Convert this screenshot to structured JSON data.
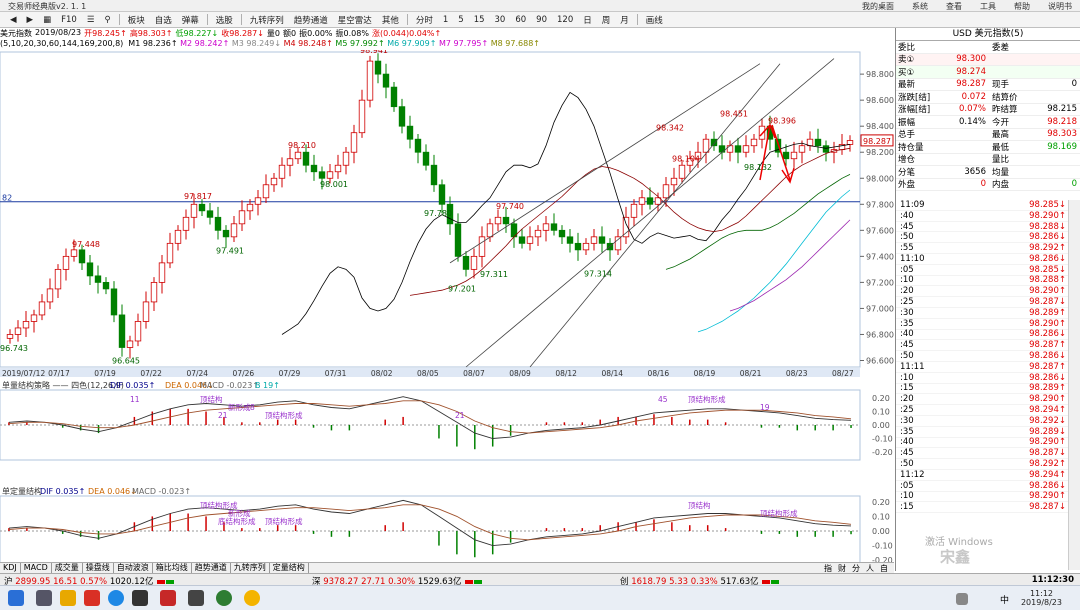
{
  "window": {
    "title": "交易师经典版v2. 1. 1",
    "menus": [
      "我的桌面",
      "系统",
      "查看",
      "工具",
      "帮助",
      "说明书"
    ]
  },
  "toolbar": {
    "left_items": [
      "板块",
      "自选",
      "弹幕"
    ],
    "items": [
      "选股",
      "九转序列",
      "趋势通道",
      "星空雷达",
      "其他"
    ],
    "periods": [
      "分时",
      "1",
      "5",
      "15",
      "30",
      "60",
      "90",
      "120",
      "日",
      "周",
      "月"
    ],
    "draw": "画线"
  },
  "quote_line": {
    "name": "美元指数",
    "date": "2019/08/23",
    "open": "开98.245↑",
    "high": "高98.303↑",
    "low": "低98.227↓",
    "close": "收98.287↓",
    "volume": "量0",
    "amount": "额0",
    "change_pct": "振0.00%",
    "amp": "振0.08%",
    "chg": "涨(0.044)0.04%↑"
  },
  "ma_line": {
    "params": "(5,10,20,30,60,144,169,200,8)",
    "items": [
      {
        "label": "M1 98.236↑",
        "color": "#000000"
      },
      {
        "label": "M2 98.242↑",
        "color": "#cc00cc"
      },
      {
        "label": "M3 98.249↓",
        "color": "#888888"
      },
      {
        "label": "M4 98.248↑",
        "color": "#cc0000"
      },
      {
        "label": "M5 97.992↑",
        "color": "#008800"
      },
      {
        "label": "M6 97.909↑",
        "color": "#00aaaa"
      },
      {
        "label": "M7 97.795↑",
        "color": "#cc00cc"
      },
      {
        "label": "M8 97.688↑",
        "color": "#888800"
      }
    ]
  },
  "chart_data": {
    "type": "candlestick",
    "title": "美元指数",
    "x_ticks": [
      "2019/07/12",
      "07/17",
      "07/19",
      "07/22",
      "07/24",
      "07/26",
      "07/29",
      "07/31",
      "08/02",
      "08/05",
      "08/07",
      "08/09",
      "08/12",
      "08/14",
      "08/16",
      "08/19",
      "08/21",
      "08/23",
      "08/27"
    ],
    "y_ticks": [
      96.6,
      96.8,
      97.0,
      97.2,
      97.4,
      97.6,
      97.8,
      98.0,
      98.2,
      98.4,
      98.6,
      98.8
    ],
    "ylim": [
      96.55,
      98.97
    ],
    "h_line": 97.82,
    "h_line_label": "82",
    "annotations": [
      {
        "text": "96.743",
        "v": 96.743
      },
      {
        "text": "97.448",
        "v": 97.448
      },
      {
        "text": "96.645",
        "v": 96.645
      },
      {
        "text": "97.817",
        "v": 97.817
      },
      {
        "text": "97.491",
        "v": 97.491
      },
      {
        "text": "98.210",
        "v": 98.21
      },
      {
        "text": "98.001",
        "v": 98.001
      },
      {
        "text": "98.941",
        "v": 98.941
      },
      {
        "text": "97.780",
        "v": 97.78
      },
      {
        "text": "97.201",
        "v": 97.201
      },
      {
        "text": "97.311",
        "v": 97.311
      },
      {
        "text": "97.740",
        "v": 97.74
      },
      {
        "text": "97.314",
        "v": 97.314
      },
      {
        "text": "98.342",
        "v": 98.342
      },
      {
        "text": "98.104",
        "v": 98.104
      },
      {
        "text": "98.451",
        "v": 98.451
      },
      {
        "text": "98.396",
        "v": 98.396
      },
      {
        "text": "98.132",
        "v": 98.132
      }
    ],
    "current_price": "98.287",
    "closes": [
      96.8,
      96.85,
      96.9,
      96.95,
      97.05,
      97.15,
      97.3,
      97.4,
      97.45,
      97.35,
      97.25,
      97.2,
      97.15,
      96.95,
      96.7,
      96.75,
      96.9,
      97.05,
      97.2,
      97.35,
      97.5,
      97.6,
      97.7,
      97.8,
      97.75,
      97.7,
      97.6,
      97.55,
      97.65,
      97.75,
      97.8,
      97.85,
      97.95,
      98.0,
      98.1,
      98.15,
      98.2,
      98.1,
      98.05,
      98.0,
      98.05,
      98.1,
      98.2,
      98.35,
      98.6,
      98.9,
      98.8,
      98.7,
      98.55,
      98.4,
      98.3,
      98.2,
      98.1,
      97.95,
      97.8,
      97.65,
      97.4,
      97.3,
      97.4,
      97.55,
      97.65,
      97.7,
      97.65,
      97.55,
      97.5,
      97.55,
      97.6,
      97.65,
      97.6,
      97.55,
      97.5,
      97.45,
      97.5,
      97.55,
      97.5,
      97.45,
      97.55,
      97.7,
      97.8,
      97.85,
      97.8,
      97.85,
      97.95,
      98.0,
      98.1,
      98.15,
      98.2,
      98.3,
      98.25,
      98.2,
      98.25,
      98.2,
      98.25,
      98.3,
      98.4,
      98.3,
      98.2,
      98.15,
      98.2,
      98.25,
      98.3,
      98.25,
      98.2,
      98.22,
      98.26,
      98.29
    ],
    "ma_series": [
      {
        "name": "M5",
        "values": [
          96.8,
          96.84,
          96.88,
          96.96,
          97.06,
          97.17,
          97.27,
          97.32,
          97.3,
          97.24,
          97.08,
          97.0,
          96.98,
          97.0,
          97.07,
          97.2,
          97.36,
          97.5,
          97.61,
          97.68,
          97.72,
          97.69,
          97.66,
          97.66,
          97.72,
          97.79,
          97.85,
          97.95,
          98.05,
          98.1,
          98.1,
          98.08,
          98.11,
          98.25,
          98.43,
          98.56,
          98.66,
          98.62,
          98.53,
          98.4,
          98.22,
          98.04,
          97.84,
          97.65,
          97.53,
          97.5,
          97.55,
          97.58,
          97.56,
          97.54,
          97.55,
          97.56,
          97.53,
          97.52,
          97.59,
          97.68,
          97.75,
          97.84,
          97.92,
          98.02,
          98.12,
          98.2,
          98.22,
          98.24,
          98.26,
          98.27,
          98.25,
          98.24,
          98.23,
          98.24,
          98.25,
          98.26
        ]
      },
      {
        "name": "M20",
        "values": [
          97.1,
          97.11,
          97.12,
          97.13,
          97.14,
          97.16,
          97.18,
          97.21,
          97.25,
          97.3,
          97.36,
          97.42,
          97.48,
          97.55,
          97.61,
          97.66,
          97.71,
          97.76,
          97.81,
          97.86,
          97.92,
          97.98,
          98.03,
          98.07,
          98.09,
          98.08,
          98.06,
          98.03,
          98.0,
          97.96,
          97.91,
          97.86,
          97.8,
          97.74,
          97.69,
          97.65,
          97.62,
          97.6,
          97.59,
          97.6,
          97.63,
          97.66,
          97.71,
          97.77,
          97.83,
          97.89,
          97.95,
          98.01,
          98.06,
          98.1,
          98.13,
          98.16,
          98.19,
          98.21,
          98.22,
          98.23
        ]
      },
      {
        "name": "M60",
        "values": [
          97.3,
          97.32,
          97.35,
          97.38,
          97.42,
          97.46,
          97.5,
          97.54,
          97.57,
          97.59,
          97.6,
          97.6,
          97.6,
          97.62,
          97.65,
          97.69,
          97.73,
          97.78,
          97.83,
          97.88,
          97.92,
          97.96,
          98.0,
          98.03
        ]
      },
      {
        "name": "M144",
        "values": [
          96.82,
          96.84,
          96.87,
          96.9,
          96.94,
          96.98,
          97.03,
          97.08,
          97.14,
          97.2,
          97.27,
          97.34,
          97.42,
          97.5,
          97.58,
          97.66,
          97.74,
          97.8,
          97.86,
          97.91
        ]
      },
      {
        "name": "M200",
        "values": [
          96.98,
          97.0,
          97.03,
          97.06,
          97.1,
          97.14,
          97.18,
          97.22,
          97.27,
          97.32,
          97.38,
          97.44,
          97.5,
          97.56,
          97.62,
          97.68
        ]
      }
    ],
    "macd1": {
      "title": "单量结构策略 —— 四色(12,26,9)",
      "dif": "DIF 0.035↑",
      "dea": "DEA 0.046↓",
      "macd": "MACD -0.023↑",
      "extra": "B 19↑",
      "y_ticks": [
        0.2,
        0.1,
        0,
        -0.1,
        -0.2
      ],
      "ylim": [
        -0.26,
        0.26
      ],
      "labels": [
        "顶结构",
        "新形成",
        "顶结构形成",
        "顶结构形成",
        "19",
        "21",
        "11",
        "8",
        "21",
        "45"
      ],
      "dif_values": [
        0.02,
        0.03,
        0.02,
        0.0,
        -0.03,
        -0.05,
        -0.02,
        0.03,
        0.08,
        0.12,
        0.15,
        0.16,
        0.15,
        0.14,
        0.15,
        0.17,
        0.18,
        0.15,
        0.13,
        0.12,
        0.15,
        0.18,
        0.21,
        0.18,
        0.1,
        0.02,
        -0.06,
        -0.1,
        -0.09,
        -0.06,
        -0.04,
        -0.03,
        -0.02,
        0.0,
        0.03,
        0.06,
        0.09,
        0.1,
        0.11,
        0.12,
        0.12,
        0.11,
        0.1,
        0.09,
        0.07,
        0.05,
        0.04,
        0.035
      ],
      "dea_values": [
        0.01,
        0.02,
        0.02,
        0.01,
        -0.01,
        -0.02,
        -0.02,
        0.0,
        0.03,
        0.06,
        0.09,
        0.11,
        0.12,
        0.13,
        0.14,
        0.15,
        0.16,
        0.16,
        0.15,
        0.14,
        0.15,
        0.16,
        0.18,
        0.18,
        0.15,
        0.1,
        0.03,
        -0.02,
        -0.05,
        -0.06,
        -0.05,
        -0.04,
        -0.03,
        -0.02,
        0.0,
        0.03,
        0.05,
        0.07,
        0.09,
        0.1,
        0.11,
        0.11,
        0.11,
        0.1,
        0.09,
        0.07,
        0.06,
        0.046
      ]
    },
    "macd2": {
      "title": "单定量结构",
      "dif": "DIF 0.035↑",
      "dea": "DEA 0.046↓",
      "macd": "MACD -0.023↑",
      "y_ticks": [
        0.2,
        0.1,
        0,
        -0.1,
        -0.2
      ],
      "ylim": [
        -0.24,
        0.24
      ],
      "labels": [
        "顶结构形成",
        "新形成",
        "顶结构形成",
        "顶结构",
        "顶结构形成",
        "底结构形成"
      ],
      "dif_values": [
        0.02,
        0.03,
        0.02,
        0.0,
        -0.03,
        -0.05,
        -0.02,
        0.03,
        0.08,
        0.12,
        0.15,
        0.16,
        0.15,
        0.14,
        0.15,
        0.17,
        0.18,
        0.15,
        0.13,
        0.12,
        0.15,
        0.18,
        0.21,
        0.18,
        0.1,
        0.02,
        -0.06,
        -0.1,
        -0.09,
        -0.06,
        -0.04,
        -0.03,
        -0.02,
        0.0,
        0.03,
        0.06,
        0.09,
        0.1,
        0.11,
        0.12,
        0.12,
        0.11,
        0.1,
        0.09,
        0.07,
        0.05,
        0.04,
        0.035
      ],
      "dea_values": [
        0.01,
        0.02,
        0.02,
        0.01,
        -0.01,
        -0.02,
        -0.02,
        0.0,
        0.03,
        0.06,
        0.09,
        0.11,
        0.12,
        0.13,
        0.14,
        0.15,
        0.16,
        0.16,
        0.15,
        0.14,
        0.15,
        0.16,
        0.18,
        0.18,
        0.15,
        0.1,
        0.03,
        -0.02,
        -0.05,
        -0.06,
        -0.05,
        -0.04,
        -0.03,
        -0.02,
        0.0,
        0.03,
        0.05,
        0.07,
        0.09,
        0.1,
        0.11,
        0.11,
        0.11,
        0.1,
        0.09,
        0.07,
        0.06,
        0.046
      ]
    }
  },
  "right_panel": {
    "title": "USD 美元指数(5)",
    "header": {
      "l": "委比",
      "r": "委差"
    },
    "sell": {
      "label": "卖①",
      "value": "98.300"
    },
    "buy": {
      "label": "买①",
      "value": "98.274"
    },
    "rows": [
      {
        "l": "最新",
        "v": "98.287",
        "vc": "red",
        "l2": "现手",
        "v2": "0",
        "v2c": "blk"
      },
      {
        "l": "涨跌[结]",
        "v": "0.072",
        "vc": "red",
        "l2": "结算价",
        "v2": "",
        "v2c": "blk"
      },
      {
        "l": "涨幅[结]",
        "v": "0.07%",
        "vc": "red",
        "l2": "昨结算",
        "v2": "98.215",
        "v2c": "blk"
      },
      {
        "l": "振幅",
        "v": "0.14%",
        "vc": "blk",
        "l2": "今开",
        "v2": "98.218",
        "v2c": "red"
      },
      {
        "l": "总手",
        "v": "",
        "vc": "blk",
        "l2": "最高",
        "v2": "98.303",
        "v2c": "red"
      },
      {
        "l": "持仓量",
        "v": "",
        "vc": "blk",
        "l2": "最低",
        "v2": "98.169",
        "v2c": "green"
      },
      {
        "l": "增仓",
        "v": "",
        "vc": "blk",
        "l2": "量比",
        "v2": "",
        "v2c": "blk"
      },
      {
        "l": "分笔",
        "v": "3656",
        "vc": "blk",
        "l2": "均量",
        "v2": "",
        "v2c": "blk"
      },
      {
        "l": "外盘",
        "v": "0",
        "vc": "red",
        "l2": "内盘",
        "v2": "0",
        "v2c": "green"
      }
    ],
    "ticks": [
      {
        "t": "11:09",
        "p": "98.285↓"
      },
      {
        "t": ":40",
        "p": "98.290↑"
      },
      {
        "t": ":45",
        "p": "98.288↓"
      },
      {
        "t": ":50",
        "p": "98.286↓"
      },
      {
        "t": ":55",
        "p": "98.292↑"
      },
      {
        "t": "11:10",
        "p": "98.286↓"
      },
      {
        "t": ":05",
        "p": "98.285↓"
      },
      {
        "t": ":10",
        "p": "98.288↑"
      },
      {
        "t": ":20",
        "p": "98.290↑"
      },
      {
        "t": ":25",
        "p": "98.287↓"
      },
      {
        "t": ":30",
        "p": "98.289↑"
      },
      {
        "t": ":35",
        "p": "98.290↑"
      },
      {
        "t": ":40",
        "p": "98.286↓"
      },
      {
        "t": ":45",
        "p": "98.287↑"
      },
      {
        "t": ":50",
        "p": "98.286↓"
      },
      {
        "t": "11:11",
        "p": "98.287↑"
      },
      {
        "t": ":10",
        "p": "98.286↓"
      },
      {
        "t": ":15",
        "p": "98.289↑"
      },
      {
        "t": ":20",
        "p": "98.290↑"
      },
      {
        "t": ":25",
        "p": "98.294↑"
      },
      {
        "t": ":30",
        "p": "98.292↓"
      },
      {
        "t": ":35",
        "p": "98.289↓"
      },
      {
        "t": ":40",
        "p": "98.290↑"
      },
      {
        "t": ":45",
        "p": "98.287↓"
      },
      {
        "t": ":50",
        "p": "98.292↑"
      },
      {
        "t": "11:12",
        "p": "98.294↑"
      },
      {
        "t": ":05",
        "p": "98.286↓"
      },
      {
        "t": ":10",
        "p": "98.290↑"
      },
      {
        "t": ":15",
        "p": "98.287↓"
      }
    ]
  },
  "tabs": [
    "KDJ",
    "MACD",
    "成交量",
    "操盘线",
    "自动波浪",
    "箱比均线",
    "趋势通道",
    "九转序列",
    "定量结构"
  ],
  "tabs_right": [
    "指",
    "财",
    "分",
    "人",
    "自"
  ],
  "status": {
    "seg1": {
      "label": "沪",
      "price": "2899.95",
      "chg": "16.51",
      "pct": "0.57%",
      "amt": "1020.12亿"
    },
    "seg2": {
      "label": "深",
      "price": "9378.27",
      "chg": "27.71",
      "pct": "0.30%",
      "amt": "1529.63亿"
    },
    "seg3": {
      "label": "创",
      "price": "1618.79",
      "chg": "5.33",
      "pct": "0.33%",
      "amt": "517.63亿"
    },
    "clock": "11:12:30"
  },
  "taskbar": {
    "time": "11:12",
    "date": "2019/8/23",
    "ime": "中"
  },
  "overlay": {
    "activation": "激活 Windows",
    "watermark": "宋鑫"
  }
}
